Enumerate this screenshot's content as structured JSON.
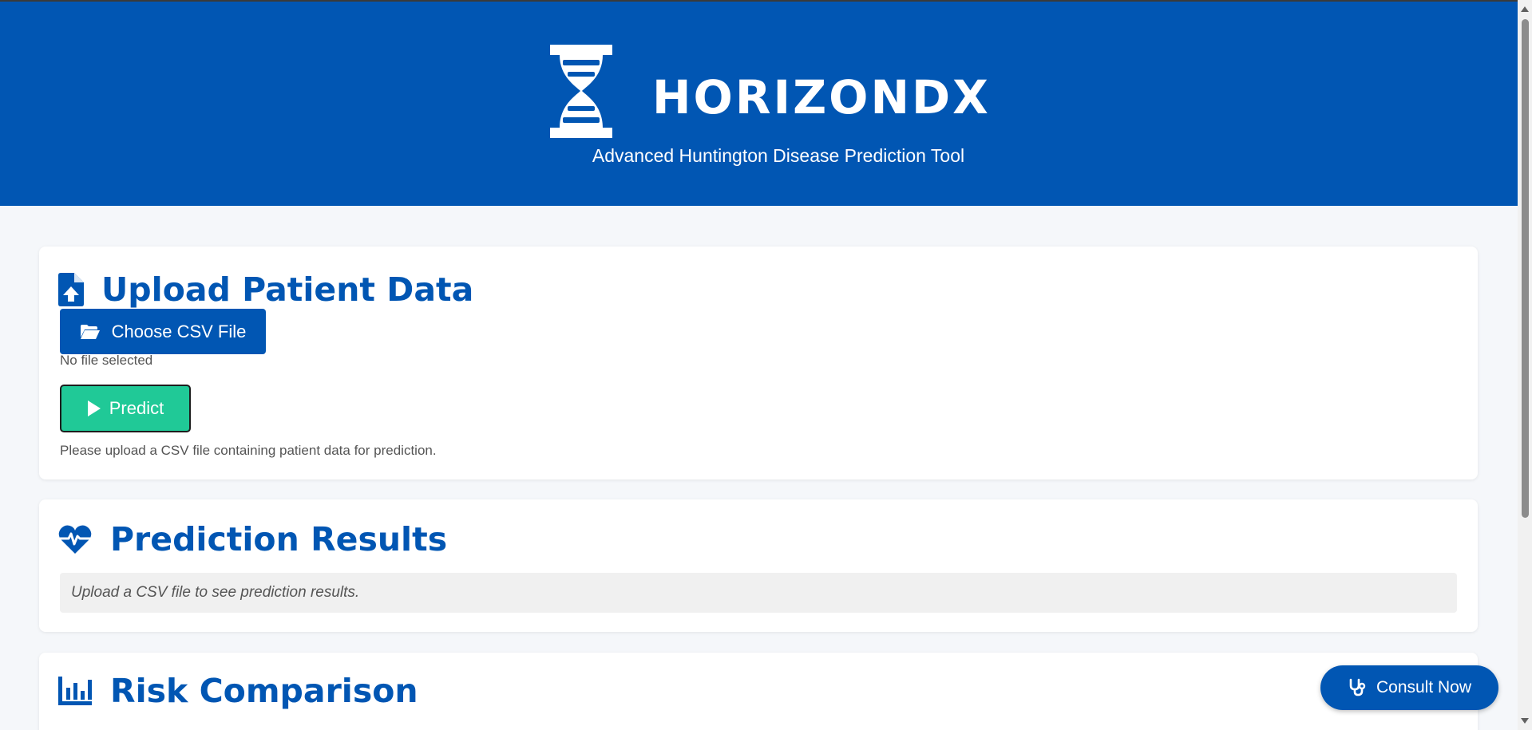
{
  "header": {
    "brand": "HORIZONDX",
    "tagline": "Advanced Huntington Disease Prediction Tool",
    "logo_icon": "dna-icon",
    "background_color": "#0156b3"
  },
  "upload": {
    "title": "Upload Patient Data",
    "title_icon": "file-upload-icon",
    "choose_label": "Choose CSV File",
    "choose_icon": "folder-open-icon",
    "file_status": "No file selected",
    "predict_label": "Predict",
    "predict_icon": "play-icon",
    "help_text": "Please upload a CSV file containing patient data for prediction."
  },
  "results": {
    "title": "Prediction Results",
    "title_icon": "heartbeat-icon",
    "placeholder": "Upload a CSV file to see prediction results."
  },
  "risk": {
    "title": "Risk Comparison",
    "title_icon": "bar-chart-icon"
  },
  "consult": {
    "label": "Consult Now",
    "icon": "stethoscope-icon"
  },
  "colors": {
    "primary": "#0156b3",
    "success": "#20c997",
    "background": "#f5f7fa"
  }
}
